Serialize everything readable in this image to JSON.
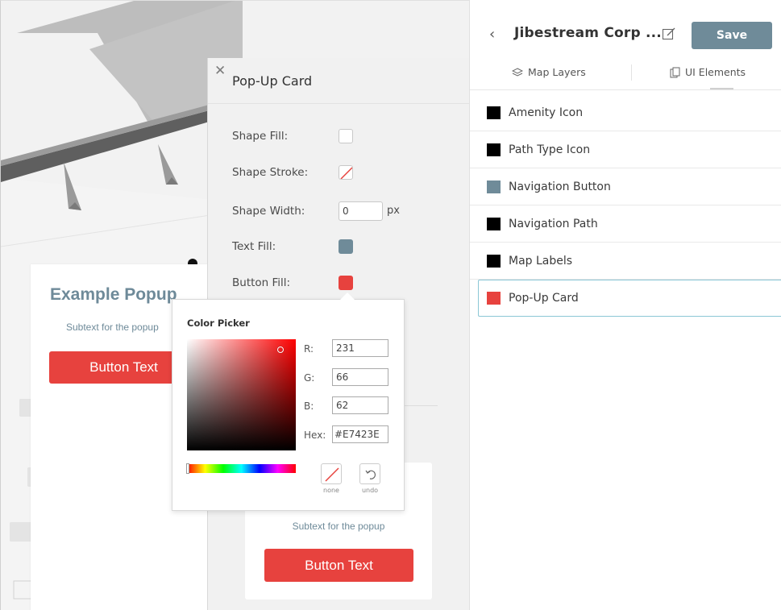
{
  "map_popup": {
    "title": "Example Popup",
    "subtext": "Subtext for the popup",
    "button": "Button Text"
  },
  "card_panel": {
    "title": "Pop-Up Card",
    "props": {
      "shape_fill": "Shape Fill:",
      "shape_stroke": "Shape Stroke:",
      "shape_width": "Shape Width:",
      "shape_width_value": "0",
      "shape_width_unit": "px",
      "text_fill": "Text Fill:",
      "button_fill": "Button Fill:"
    },
    "preview": {
      "subtext": "Subtext for the popup",
      "button": "Button Text"
    }
  },
  "color_picker": {
    "title": "Color Picker",
    "r_label": "R:",
    "g_label": "G:",
    "b_label": "B:",
    "hex_label": "Hex:",
    "r": "231",
    "g": "66",
    "b": "62",
    "hex": "#E7423E",
    "none_label": "none",
    "undo_label": "undo"
  },
  "sidebar": {
    "title": "Jibestream Corp ...",
    "save": "Save",
    "tabs": [
      {
        "label": "Map Layers",
        "icon": "layers-icon"
      },
      {
        "label": "UI Elements",
        "icon": "ui-elements-icon"
      }
    ],
    "items": [
      {
        "label": "Amenity Icon",
        "color": "#000000"
      },
      {
        "label": "Path Type Icon",
        "color": "#000000"
      },
      {
        "label": "Navigation Button",
        "color": "#6f8b99"
      },
      {
        "label": "Navigation Path",
        "color": "#000000"
      },
      {
        "label": "Map Labels",
        "color": "#000000"
      },
      {
        "label": "Pop-Up Card",
        "color": "#e7423e"
      }
    ]
  },
  "colors": {
    "accent": "#e7423e",
    "slate": "#6f8b99",
    "selection": "#8cc7d6"
  }
}
